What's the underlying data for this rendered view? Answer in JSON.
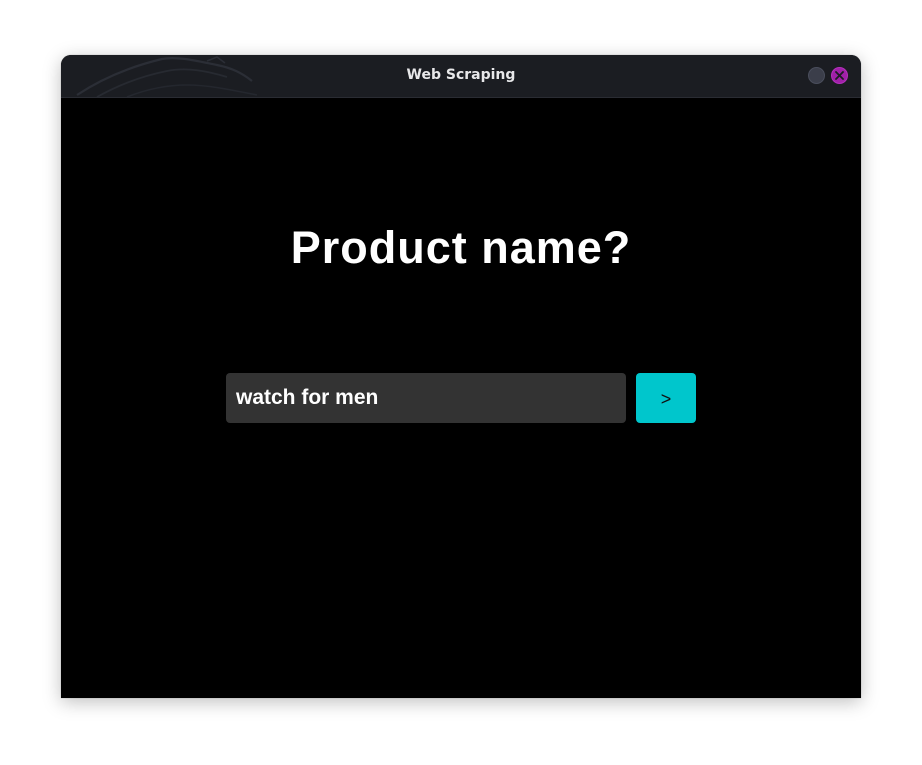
{
  "window": {
    "title": "Web Scraping",
    "minimize_icon": "circle-minimize-icon",
    "close_icon": "close-x-icon",
    "colors": {
      "titlebar": "#1b1d22",
      "close_button": "#a020a8",
      "minimize_button": "#3b3e4a"
    }
  },
  "main": {
    "heading": "Product name?",
    "search_input": {
      "value": "watch for men",
      "placeholder": ""
    },
    "submit_button": {
      "label": ">",
      "color": "#00c6cc"
    },
    "background": "#000000"
  }
}
